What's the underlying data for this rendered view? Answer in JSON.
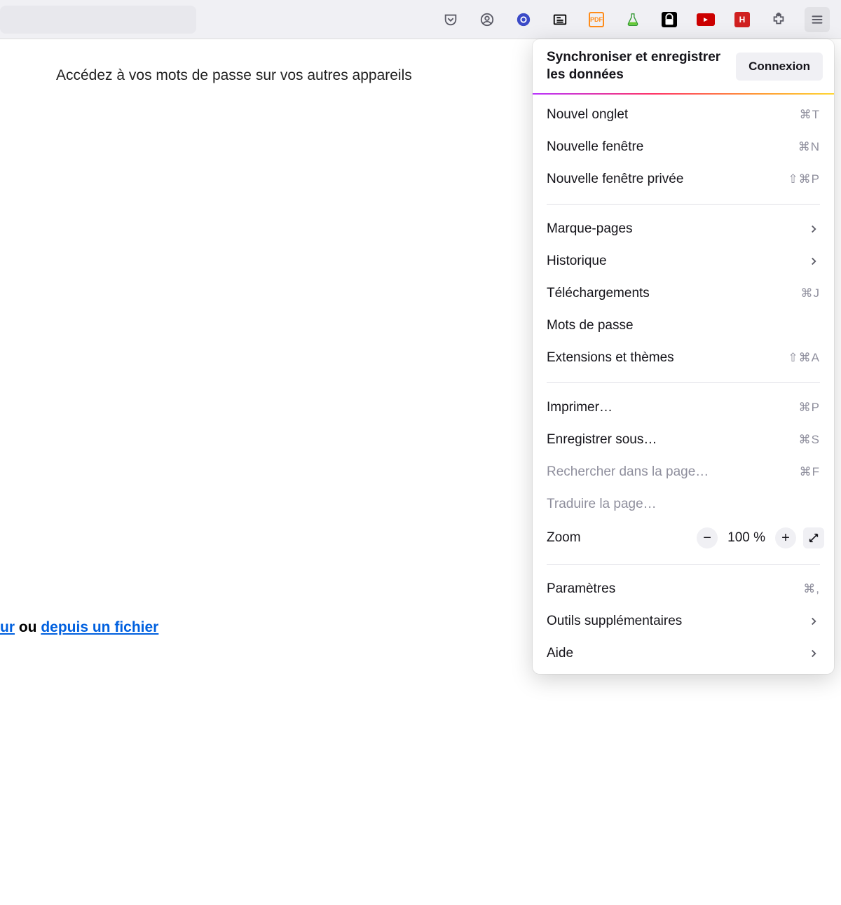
{
  "page": {
    "sync_prompt": "Accédez à vos mots de passe sur vos autres appareils",
    "import_prefix": "ur",
    "import_mid": " ou ",
    "import_link": "depuis un fichier"
  },
  "menu": {
    "header": {
      "title": "Synchroniser et enregistrer les données",
      "button": "Connexion"
    },
    "items_a": [
      {
        "label": "Nouvel onglet",
        "shortcut": "⌘T"
      },
      {
        "label": "Nouvelle fenêtre",
        "shortcut": "⌘N"
      },
      {
        "label": "Nouvelle fenêtre privée",
        "shortcut": "⇧⌘P"
      }
    ],
    "items_b": [
      {
        "label": "Marque-pages",
        "chevron": true
      },
      {
        "label": "Historique",
        "chevron": true
      },
      {
        "label": "Téléchargements",
        "shortcut": "⌘J"
      },
      {
        "label": "Mots de passe"
      },
      {
        "label": "Extensions et thèmes",
        "shortcut": "⇧⌘A"
      }
    ],
    "items_c": [
      {
        "label": "Imprimer…",
        "shortcut": "⌘P"
      },
      {
        "label": "Enregistrer sous…",
        "shortcut": "⌘S"
      },
      {
        "label": "Rechercher dans la page…",
        "shortcut": "⌘F",
        "disabled": true
      },
      {
        "label": "Traduire la page…",
        "disabled": true
      }
    ],
    "zoom": {
      "label": "Zoom",
      "value": "100 %"
    },
    "items_d": [
      {
        "label": "Paramètres",
        "shortcut": "⌘,"
      },
      {
        "label": "Outils supplémentaires",
        "chevron": true
      },
      {
        "label": "Aide",
        "chevron": true
      }
    ]
  }
}
